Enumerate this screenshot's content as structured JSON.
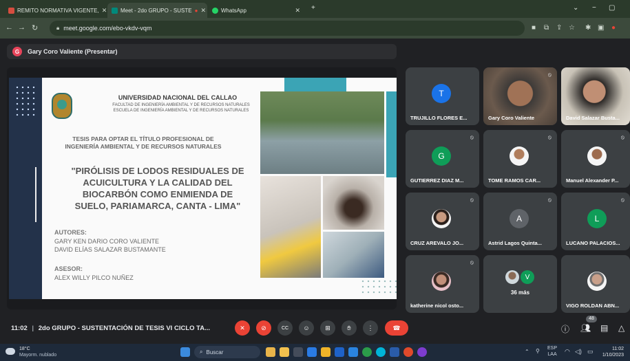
{
  "browser": {
    "tabs": [
      {
        "label": "REMITO NORMATIVA VIGENTE, ",
        "color": "#d54d3f"
      },
      {
        "label": "Meet - 2do GRUPO - SUSTE",
        "color": "#00897b"
      },
      {
        "label": "WhatsApp",
        "color": "#25d366"
      }
    ],
    "url": "meet.google.com/ebo-vkdv-vqm"
  },
  "presenter": {
    "initial": "G",
    "label": "Gary Coro Valiente (Presentar)"
  },
  "slide": {
    "university": "UNIVERSIDAD NACIONAL DEL CALLAO",
    "faculty": "FACULTAD DE INGENIERÍA AMBIENTAL Y DE RECURSOS NATURALES",
    "school": "ESCUELA DE INGENIERÍA AMBIENTAL Y DE RECURSOS NATURALES",
    "tesis_line1": "TESIS PARA OPTAR EL TÍTULO PROFESIONAL DE",
    "tesis_line2": "INGENIERÍA AMBIENTAL Y DE RECURSOS NATURALES",
    "title_lines": [
      "\"PIRÓLISIS DE LODOS RESIDUALES DE",
      "ACUICULTURA Y LA CALIDAD DEL",
      "BIOCARBÓN COMO ENMIENDA DE",
      "SUELO, PARIAMARCA, CANTA - LIMA\""
    ],
    "authors_heading": "AUTORES:",
    "authors": [
      "GARY KEN DARIO CORO VALIENTE",
      "DAVID ELÍAS SALAZAR BUSTAMANTE"
    ],
    "advisor_heading": "ASESOR:",
    "advisor": "ALEX WILLY PILCO NUÑEZ"
  },
  "participants": [
    {
      "name": "TRUJILLO FLORES E...",
      "initial": "T",
      "color": "#1a73e8",
      "video": false
    },
    {
      "name": "Gary Coro Valiente",
      "initial": "",
      "color": "",
      "video": true
    },
    {
      "name": "David Salazar Busta...",
      "initial": "",
      "color": "",
      "video": true
    },
    {
      "name": "GUTIERREZ DIAZ M...",
      "initial": "G",
      "color": "#0f9d58",
      "video": false
    },
    {
      "name": "TOME RAMOS CAR...",
      "initial": "",
      "color": "#f5f5f5",
      "video": false
    },
    {
      "name": "Manuel Alexander P...",
      "initial": "",
      "color": "#f5f5f5",
      "video": false
    },
    {
      "name": "CRUZ AREVALO JO...",
      "initial": "",
      "color": "#f5f5f5",
      "video": false
    },
    {
      "name": "Astrid Lagos Quinta...",
      "initial": "A",
      "color": "#5f6368",
      "video": false
    },
    {
      "name": "LUCANO PALACIOS...",
      "initial": "L",
      "color": "#0f9d58",
      "video": false
    },
    {
      "name": "katherine nicol osto...",
      "initial": "",
      "color": "#f5f5f5",
      "video": false
    },
    {
      "name": "",
      "initial": "",
      "color": "",
      "video": false
    },
    {
      "name": "VIGO ROLDAN ABN...",
      "initial": "",
      "color": "#f5f5f5",
      "video": false
    }
  ],
  "more": {
    "initial": "V",
    "label": "36 más"
  },
  "meeting": {
    "time": "11:02",
    "title": "2do GRUPO - SUSTENTACIÓN DE TESIS VI CICLO TA...",
    "people_count": "48"
  },
  "taskbar": {
    "weather_temp": "18°C",
    "weather_desc": "Mayorm. nublado",
    "search": "Buscar",
    "lang1": "ESP",
    "lang2": "LAA",
    "clock_time": "11:02",
    "clock_date": "1/10/2023"
  }
}
